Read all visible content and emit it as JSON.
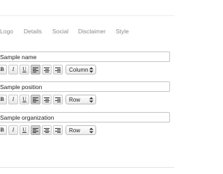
{
  "tabs": [
    {
      "label": "Logo"
    },
    {
      "label": "Details"
    },
    {
      "label": "Social"
    },
    {
      "label": "Disclaimer"
    },
    {
      "label": "Style"
    }
  ],
  "fields": [
    {
      "value": "Sample name",
      "layout_option": "Column"
    },
    {
      "value": "Sample position",
      "layout_option": "Row"
    },
    {
      "value": "Sample organization",
      "layout_option": "Row"
    }
  ],
  "toolbar": {
    "bold_label": "B",
    "italic_label": "I",
    "underline_label": "U"
  }
}
